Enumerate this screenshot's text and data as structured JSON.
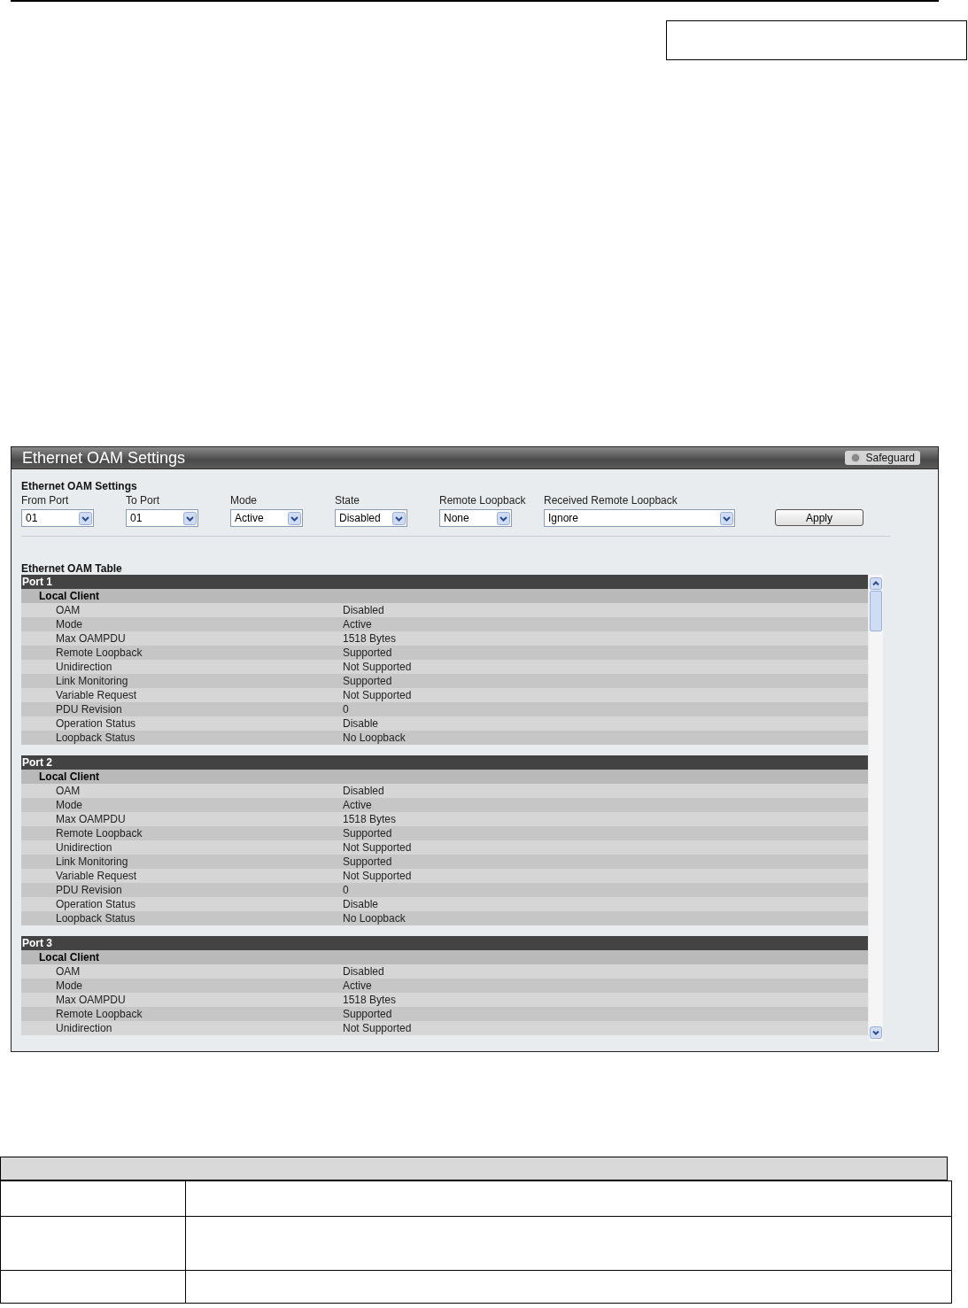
{
  "panel": {
    "title": "Ethernet OAM Settings",
    "safeguard": "Safeguard"
  },
  "settings": {
    "title": "Ethernet OAM Settings",
    "fields": [
      {
        "label": "From Port",
        "value": "01",
        "kind": "short"
      },
      {
        "label": "To Port",
        "value": "01",
        "kind": "short"
      },
      {
        "label": "Mode",
        "value": "Active",
        "kind": "short"
      },
      {
        "label": "State",
        "value": "Disabled",
        "kind": "short"
      },
      {
        "label": "Remote Loopback",
        "value": "None",
        "kind": "short"
      },
      {
        "label": "Received Remote Loopback",
        "value": "Ignore",
        "kind": "long"
      }
    ],
    "apply": "Apply"
  },
  "table": {
    "title": "Ethernet OAM Table",
    "ports": [
      {
        "header": "Port 1",
        "group": "Local Client",
        "rows": [
          [
            "OAM",
            "Disabled"
          ],
          [
            "Mode",
            "Active"
          ],
          [
            "Max OAMPDU",
            "1518 Bytes"
          ],
          [
            "Remote Loopback",
            "Supported"
          ],
          [
            "Unidirection",
            "Not Supported"
          ],
          [
            "Link Monitoring",
            "Supported"
          ],
          [
            "Variable Request",
            "Not Supported"
          ],
          [
            "PDU Revision",
            "0"
          ],
          [
            "Operation Status",
            "Disable"
          ],
          [
            "Loopback Status",
            "No Loopback"
          ]
        ]
      },
      {
        "header": "Port 2",
        "group": "Local Client",
        "rows": [
          [
            "OAM",
            "Disabled"
          ],
          [
            "Mode",
            "Active"
          ],
          [
            "Max OAMPDU",
            "1518 Bytes"
          ],
          [
            "Remote Loopback",
            "Supported"
          ],
          [
            "Unidirection",
            "Not Supported"
          ],
          [
            "Link Monitoring",
            "Supported"
          ],
          [
            "Variable Request",
            "Not Supported"
          ],
          [
            "PDU Revision",
            "0"
          ],
          [
            "Operation Status",
            "Disable"
          ],
          [
            "Loopback Status",
            "No Loopback"
          ]
        ]
      },
      {
        "header": "Port 3",
        "group": "Local Client",
        "rows": [
          [
            "OAM",
            "Disabled"
          ],
          [
            "Mode",
            "Active"
          ],
          [
            "Max OAMPDU",
            "1518 Bytes"
          ],
          [
            "Remote Loopback",
            "Supported"
          ],
          [
            "Unidirection",
            "Not Supported"
          ]
        ]
      }
    ]
  }
}
